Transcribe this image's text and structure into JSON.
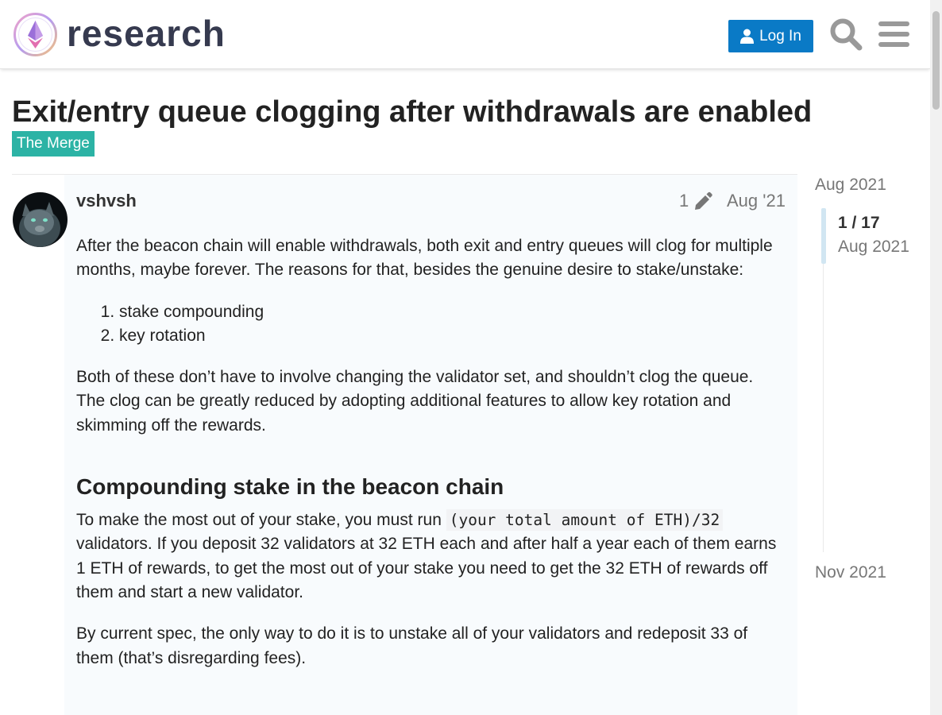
{
  "header": {
    "logo_text": "research",
    "login_label": "Log In",
    "search_icon": "search-icon",
    "menu_icon": "hamburger-menu-icon"
  },
  "topic": {
    "title": "Exit/entry queue clogging after withdrawals are enabled",
    "category": "The Merge",
    "category_color": "#2cb3a5"
  },
  "post": {
    "author": "vshvsh",
    "edit_count": "1",
    "date": "Aug '21",
    "intro": "After the beacon chain will enable withdrawals, both exit and entry queues will clog for multiple months, maybe forever. The reasons for that, besides the genuine desire to stake/unstake:",
    "reasons": [
      "stake compounding",
      "key rotation"
    ],
    "para2": "Both of these don’t have to involve changing the validator set, and shouldn’t clog the queue. The clog can be greatly reduced by adopting additional features to allow key rotation and skimming off the rewards.",
    "heading": "Compounding stake in the beacon chain",
    "para3_start": "To make the most out of your stake, you must run ",
    "para3_code": "(your total amount of ETH)/32",
    "para3_end": " validators. If you deposit 32 validators at 32 ETH each and after half a year each of them earns 1 ETH of rewards, to get the most out of your stake you need to get the 32 ETH of rewards off them and start a new validator.",
    "para4": "By current spec, the only way to do it is to unstake all of your validators and redeposit 33 of them (that’s disregarding fees)."
  },
  "timeline": {
    "start": "Aug 2021",
    "progress": "1 / 17",
    "current_date": "Aug 2021",
    "end": "Nov 2021"
  },
  "colors": {
    "accent": "#0a7ac6",
    "category": "#2cb3a5"
  }
}
